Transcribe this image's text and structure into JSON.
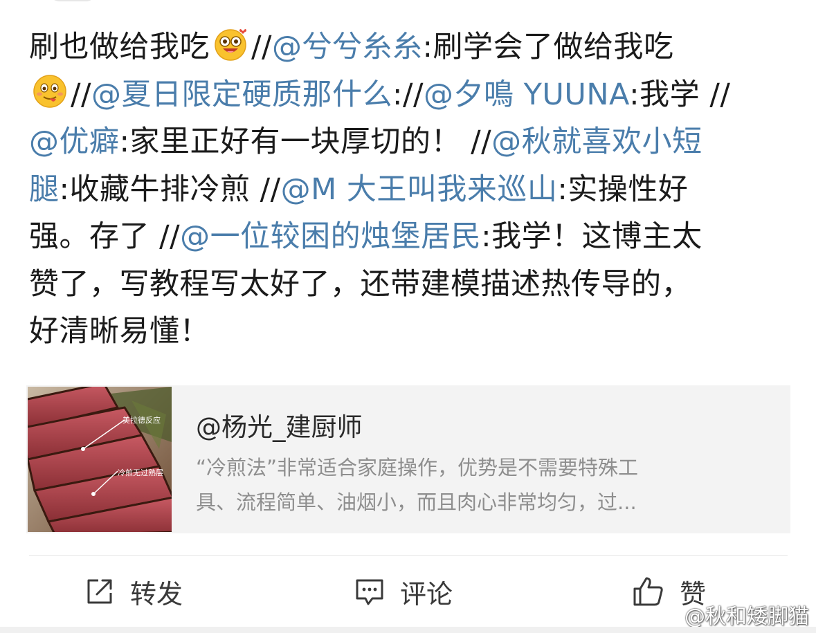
{
  "post": {
    "line1": {
      "t1": "刷也做给我吃",
      "emoji1": "drooling-love-emoji",
      "t2": "//",
      "m1": "@兮兮糸糸",
      "t3": ":刷学会了做给我吃"
    },
    "line2": {
      "emoji2": "tongue-out-emoji",
      "t1": "//",
      "m1": "@夏日限定硬质那什么",
      "t2": "://",
      "m2": "@夕鳴 YUUNA",
      "t3": ":我学 //"
    },
    "line3": {
      "m1": "@优癖",
      "t1": ":家里正好有一块厚切的！ //",
      "m2": "@秋就喜欢小短"
    },
    "line4": {
      "m1": "腿",
      "t1": ":收藏牛排冷煎 //",
      "m2": "@M 大王叫我来巡山",
      "t2": ":实操性好"
    },
    "line5": {
      "t1": "强。存了 //",
      "m1": "@一位较困的烛堡居民",
      "t2": ":我学！这博主太"
    },
    "line6": "赞了，写教程写太好了，还带建模描述热传导的，",
    "line7": "好清晰易懂！"
  },
  "card": {
    "thumb_label_1": "美拉德反应",
    "thumb_label_2": "冷煎无过熟层",
    "title": "@杨光_建厨师",
    "desc_line1": "“冷煎法”非常适合家庭操作，优势是不需要特殊工",
    "desc_line2": "具、流程简单、油烟小，而且肉心非常均匀，过..."
  },
  "actions": {
    "repost": {
      "label": "转发",
      "icon": "share-icon"
    },
    "comment": {
      "label": "评论",
      "icon": "comment-icon"
    },
    "like": {
      "label": "赞",
      "icon": "thumbs-up-icon"
    }
  },
  "watermark": {
    "text": "@秋和矮脚猫",
    "icon": "weibo-icon"
  },
  "colors": {
    "mention": "#4a7dab",
    "text": "#1b1b1b",
    "card_bg": "#f3f3f3",
    "card_desc": "#8e8e8e"
  }
}
